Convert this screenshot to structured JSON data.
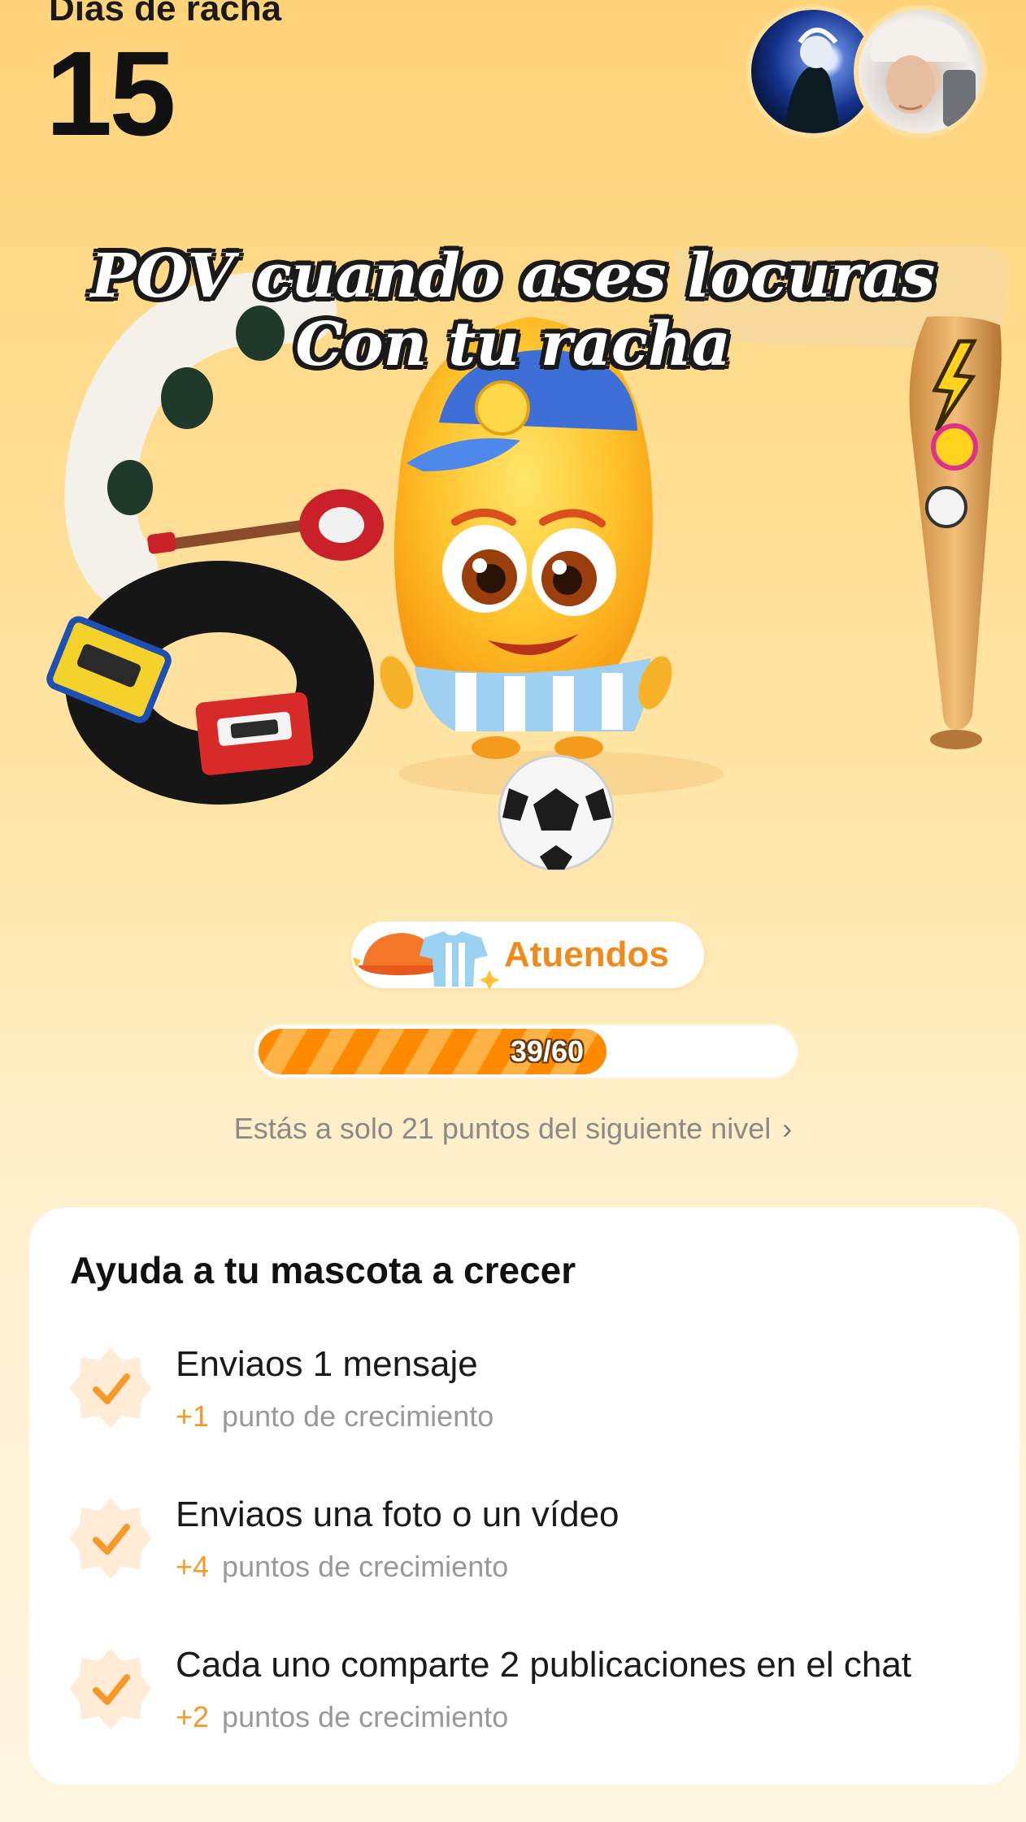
{
  "header": {
    "streak_label": "Días de racha",
    "streak_count": "15"
  },
  "avatars": [
    {
      "name": "user-avatar-1"
    },
    {
      "name": "user-avatar-2"
    }
  ],
  "overlay_text": {
    "line1": "POV cuando ases locuras",
    "line2": "Con tu racha"
  },
  "outfit_chip": {
    "label": "Atuendos",
    "icons": [
      "cap-icon",
      "shirt-icon"
    ]
  },
  "progress": {
    "current": 39,
    "max": 60,
    "text": "39/60",
    "next_level_text": "Estás a solo 21 puntos del siguiente nivel",
    "chevron": "›"
  },
  "card": {
    "title": "Ayuda a tu mascota a crecer",
    "tasks": [
      {
        "title": "Enviaos 1 mensaje",
        "points": "+1",
        "points_label": "punto de crecimiento",
        "done": true
      },
      {
        "title": "Enviaos una foto o un vídeo",
        "points": "+4",
        "points_label": "puntos de crecimiento",
        "done": true
      },
      {
        "title": "Cada uno comparte 2 publicaciones en el chat",
        "points": "+2",
        "points_label": "puntos de crecimiento",
        "done": true
      }
    ]
  },
  "colors": {
    "accent": "#F08A1B",
    "progress_fill": "#FF8A00",
    "background_top": "#FFD37A",
    "background_bottom": "#FFF6E2"
  }
}
